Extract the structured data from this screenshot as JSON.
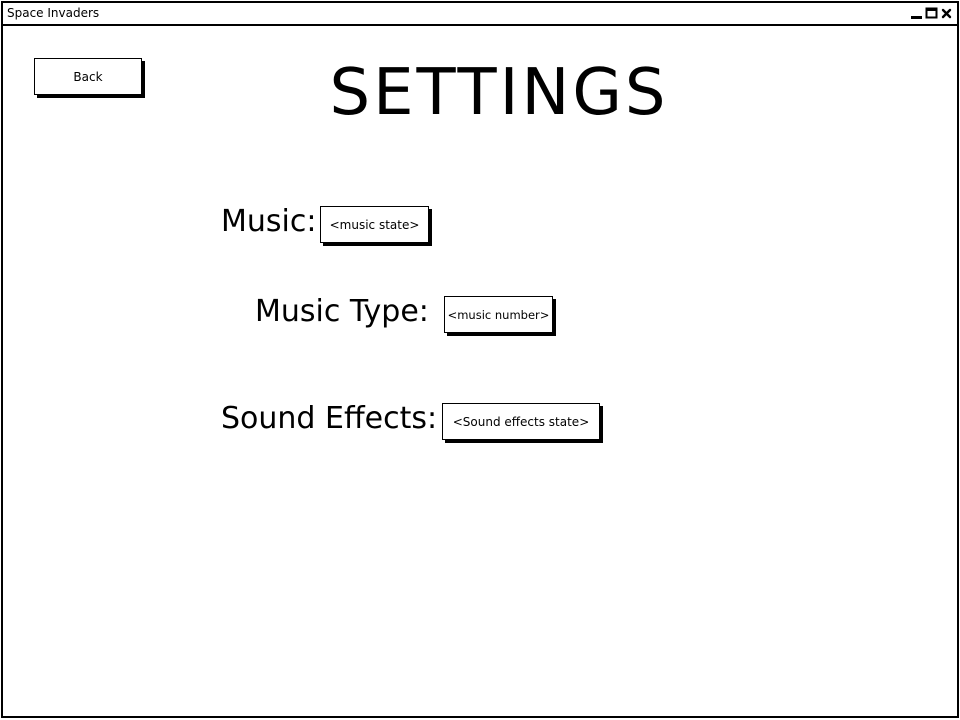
{
  "window": {
    "title": "Space Invaders",
    "controls": {
      "minimize_icon": "minimize-icon",
      "maximize_icon": "maximize-icon",
      "close_icon": "close-icon"
    }
  },
  "header": {
    "back_label": "Back",
    "title": "SETTINGS"
  },
  "settings": {
    "music": {
      "label": "Music:",
      "value": "<music state>"
    },
    "music_type": {
      "label": "Music Type:",
      "value": "<music number>"
    },
    "sound_effects": {
      "label": "Sound Effects:",
      "value": "<Sound effects state>"
    }
  },
  "colors": {
    "foreground": "#000000",
    "background": "#ffffff"
  }
}
